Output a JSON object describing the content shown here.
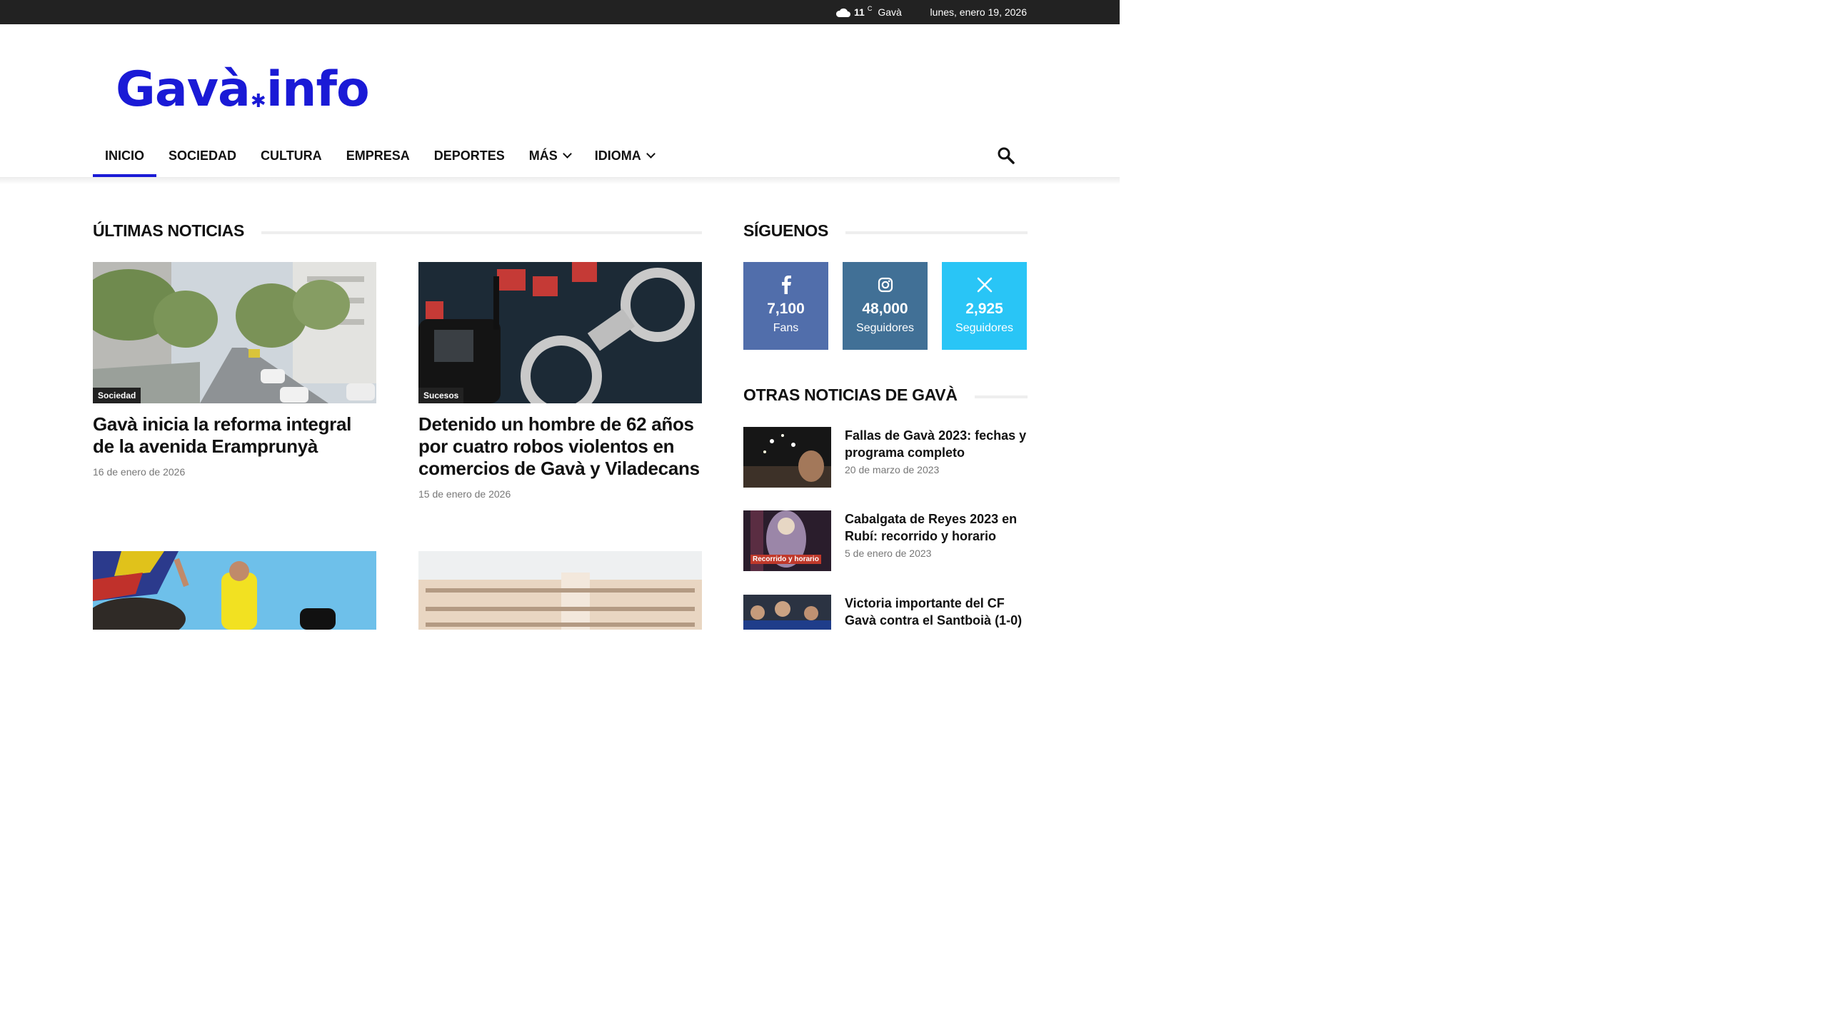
{
  "topbar": {
    "temperature": "11",
    "unit": "C",
    "city": "Gavà",
    "date": "lunes, enero 19, 2026"
  },
  "logo": {
    "left": "Gavà",
    "right": "info"
  },
  "nav": [
    {
      "label": "INICIO",
      "active": true
    },
    {
      "label": "SOCIEDAD"
    },
    {
      "label": "CULTURA"
    },
    {
      "label": "EMPRESA"
    },
    {
      "label": "DEPORTES"
    },
    {
      "label": "MÁS",
      "dropdown": true
    },
    {
      "label": "IDIOMA",
      "dropdown": true
    }
  ],
  "latest": {
    "heading": "ÚLTIMAS NOTICIAS",
    "articles": [
      {
        "category": "Sociedad",
        "title": "Gavà inicia la reforma integral de la avenida Eramprunyà",
        "date": "16 de enero de 2026"
      },
      {
        "category": "Sucesos",
        "title": "Detenido un hombre de 62 años por cuatro robos violentos en comercios de Gavà y Viladecans",
        "date": "15 de enero de 2026"
      }
    ]
  },
  "follow": {
    "heading": "SÍGUENOS",
    "networks": [
      {
        "icon": "facebook-icon",
        "count": "7,100",
        "label": "Fans",
        "color": "#516eab"
      },
      {
        "icon": "instagram-icon",
        "count": "48,000",
        "label": "Seguidores",
        "color": "#417096"
      },
      {
        "icon": "x-icon",
        "count": "2,925",
        "label": "Seguidores",
        "color": "#29c5f6"
      }
    ]
  },
  "other": {
    "heading": "OTRAS NOTICIAS DE GAVÀ",
    "items": [
      {
        "title": "Fallas de Gavà 2023: fechas y programa completo",
        "date": "20 de marzo de 2023"
      },
      {
        "title": "Cabalgata de Reyes 2023 en Rubí: recorrido y horario",
        "date": "5 de enero de 2023",
        "badge": "Recorrido y horario"
      },
      {
        "title": "Victoria importante del CF Gavà contra el Santboià (1-0)",
        "date": ""
      }
    ]
  },
  "colors": {
    "accent": "#1a1ad6",
    "topbar": "#222222"
  }
}
